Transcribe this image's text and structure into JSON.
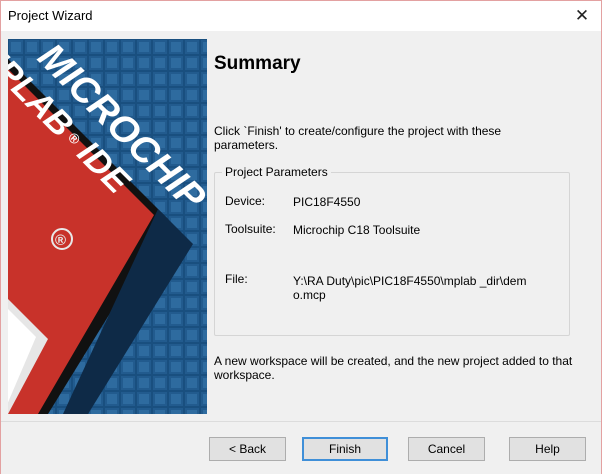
{
  "window": {
    "title": "Project Wizard",
    "close_glyph": "✕"
  },
  "banner": {
    "logo_line1": "MICROCHIP",
    "logo_line2": "MPLAB",
    "logo_registered": "®",
    "logo_line3": "IDE",
    "registered_mark": "®",
    "colors": {
      "background": "#1c4f7f",
      "accent": "#d4382a",
      "chevron": "#111111"
    }
  },
  "page": {
    "heading": "Summary",
    "intro": "Click `Finish' to create/configure the project with these parameters.",
    "group_title": "Project Parameters",
    "params": [
      {
        "label": "Device:",
        "value": "PIC18F4550"
      },
      {
        "label": "Toolsuite:",
        "value": "Microchip C18 Toolsuite"
      },
      {
        "label": "File:",
        "value": "Y:\\RA Duty\\pic\\PIC18F4550\\mplab _dir\\demo.mcp"
      }
    ],
    "footer": "A new workspace will be created, and the new project added to that workspace."
  },
  "buttons": {
    "back": "< Back",
    "finish": "Finish",
    "cancel": "Cancel",
    "help": "Help"
  },
  "colors": {
    "default_button_border": "#3f8fd8",
    "button_face": "#e1e1e1",
    "dialog_face": "#f0f0f0"
  }
}
